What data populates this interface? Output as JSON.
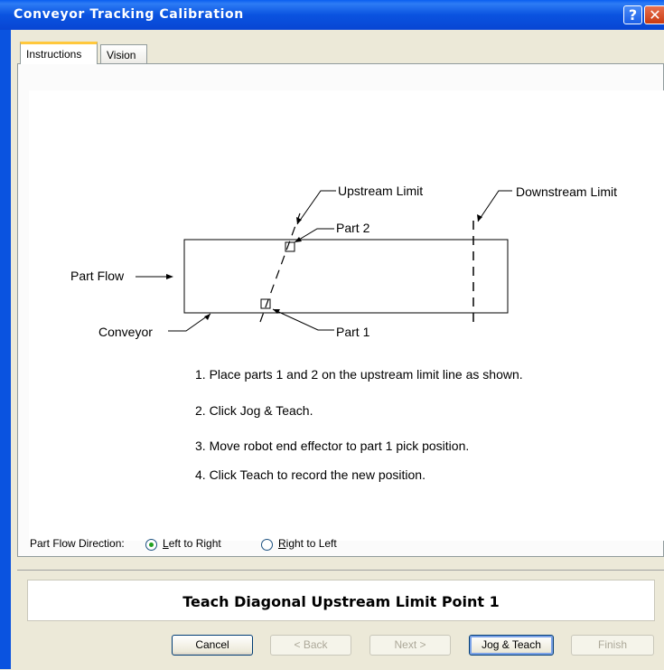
{
  "window": {
    "title": "Conveyor Tracking Calibration",
    "help_glyph": "?",
    "close_glyph": "✕"
  },
  "tabs": [
    {
      "label": "Instructions",
      "selected": true
    },
    {
      "label": "Vision",
      "selected": false
    }
  ],
  "diagram": {
    "upstream_limit": "Upstream Limit",
    "downstream_limit": "Downstream Limit",
    "part2": "Part 2",
    "part1": "Part 1",
    "part_flow": "Part Flow",
    "conveyor": "Conveyor"
  },
  "steps": [
    "1. Place parts 1 and 2 on the upstream limit line as shown.",
    "2. Click Jog & Teach.",
    "3. Move robot end effector to part 1 pick position.",
    "4. Click Teach to record the new position."
  ],
  "flow_direction": {
    "label": "Part Flow Direction:",
    "options": [
      {
        "prefix": "",
        "mnemonic": "L",
        "rest": "eft to Right",
        "selected": true
      },
      {
        "prefix": "",
        "mnemonic": "R",
        "rest": "ight to Left",
        "selected": false
      }
    ]
  },
  "status": "Teach Diagonal Upstream Limit Point 1",
  "buttons": {
    "cancel": "Cancel",
    "back": "< Back",
    "next": "Next >",
    "jog_teach": "Jog & Teach",
    "finish": "Finish"
  }
}
